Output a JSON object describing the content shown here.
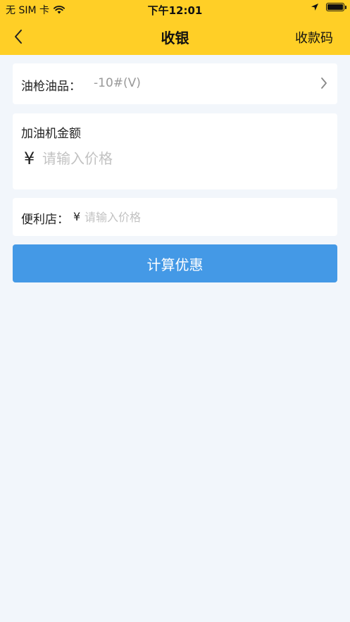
{
  "status": {
    "carrier": "无 SIM 卡",
    "time": "下午12:01"
  },
  "nav": {
    "title": "收银",
    "right_action": "收款码"
  },
  "fuel": {
    "label": "油枪油品：",
    "value": "-10#(V)"
  },
  "amount": {
    "title": "加油机金额",
    "currency": "¥",
    "placeholder": "请输入价格"
  },
  "store": {
    "label": "便利店：",
    "currency": "¥",
    "placeholder": "请输入价格"
  },
  "actions": {
    "calculate": "计算优惠"
  },
  "colors": {
    "header": "#ffcf26",
    "primary_button": "#4499e6",
    "background": "#f2f6fb"
  }
}
